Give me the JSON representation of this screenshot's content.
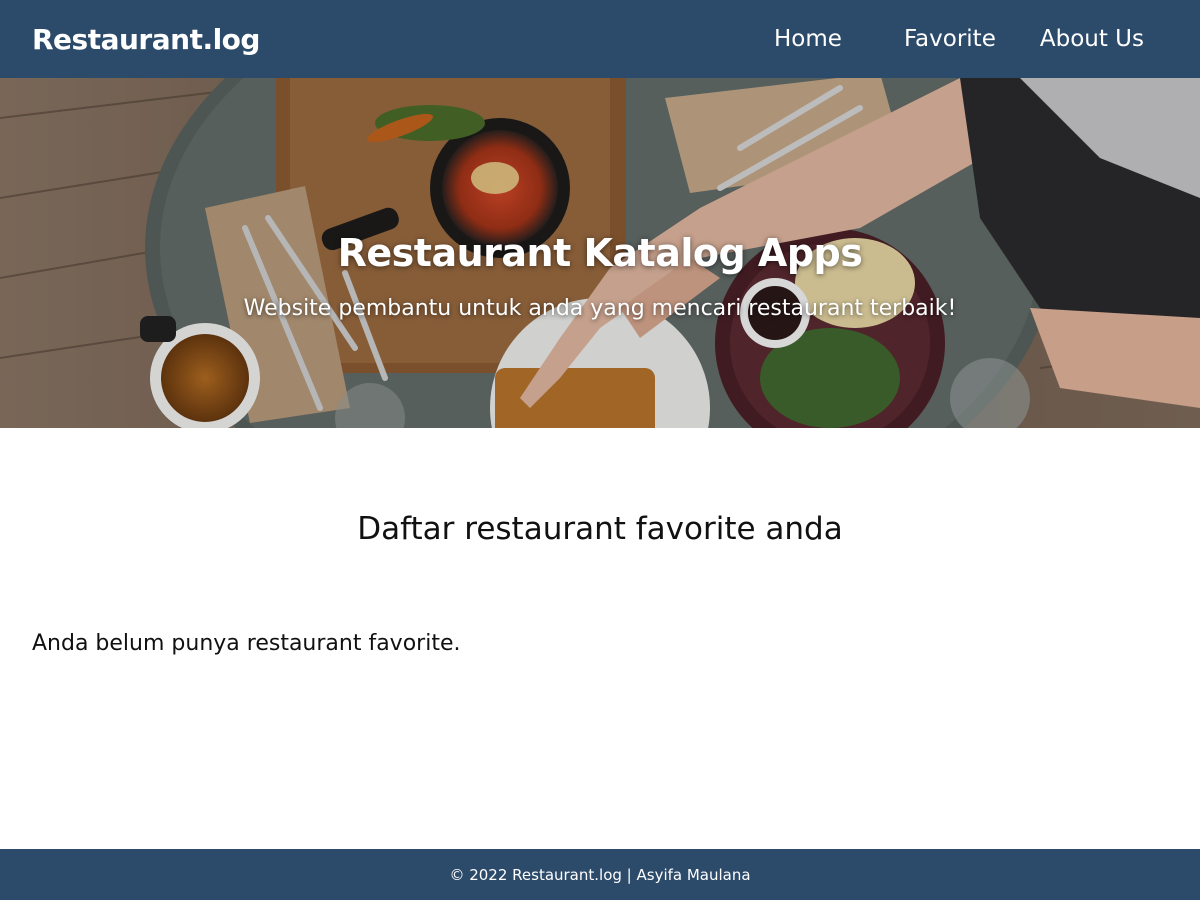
{
  "header": {
    "brand": "Restaurant.log",
    "nav": [
      {
        "label": "Home"
      },
      {
        "label": "Favorite"
      },
      {
        "label": "About Us"
      }
    ]
  },
  "hero": {
    "title": "Restaurant Katalog Apps",
    "tagline": "Website pembantu untuk anda yang mencari restaurant terbaik!"
  },
  "main": {
    "heading": "Daftar restaurant favorite anda",
    "empty_message": "Anda belum punya restaurant favorite."
  },
  "footer": {
    "text": "© 2022 Restaurant.log | Asyifa Maulana"
  },
  "colors": {
    "primary": "#2c4a69",
    "text": "#111111",
    "background": "#ffffff"
  }
}
